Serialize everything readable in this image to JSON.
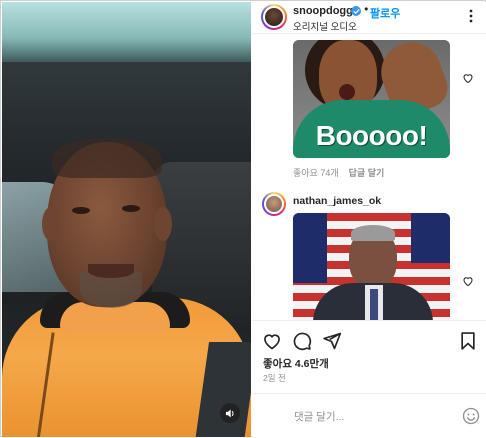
{
  "header": {
    "username": "snoopdogg",
    "follow_label": "팔로우",
    "audio_label": "오리지널 오디오",
    "separator": "•"
  },
  "comments": [
    {
      "gif_text": "Booooo!",
      "likes_label": "좋아요 74개",
      "reply_label": "답글 달기"
    },
    {
      "username": "nathan_james_ok"
    }
  ],
  "post": {
    "likes_label": "좋아요 4.6만개",
    "time_label": "2일 전"
  },
  "comment_box": {
    "placeholder": "댓글 달기..."
  },
  "colors": {
    "accent_blue": "#0095f6",
    "verified_blue": "#3897f0",
    "jacket_orange": "#f19a3a",
    "gif_green": "#1f8a6a"
  },
  "icons": [
    "verified-icon",
    "more-options-icon",
    "heart-icon",
    "comment-icon",
    "share-icon",
    "bookmark-icon",
    "emoji-icon",
    "sound-icon"
  ]
}
